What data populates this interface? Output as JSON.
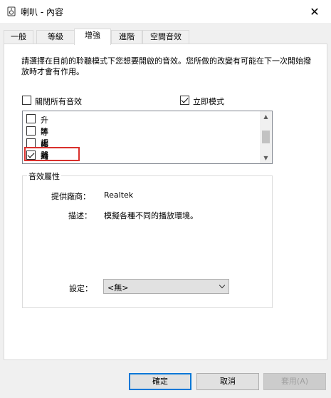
{
  "window": {
    "title": "喇叭 - 內容"
  },
  "tabs": [
    {
      "label": "一般"
    },
    {
      "label": "等級"
    },
    {
      "label": "增強"
    },
    {
      "label": "進階"
    },
    {
      "label": "空間音效"
    }
  ],
  "enhancements": {
    "description": "請選擇在目前的聆聽模式下您想要開啟的音效。您所做的改變有可能在下一次開始撥放時才會有作用。",
    "disable_all": {
      "label": "關閉所有音效",
      "checked": false
    },
    "immediate_mode": {
      "label": "立即模式",
      "checked": true
    },
    "items": [
      {
        "label": "升降調",
        "checked": false
      },
      {
        "label": "等化器",
        "checked": false
      },
      {
        "label": "虛擬環繞",
        "checked": false
      },
      {
        "label": "均衡響度",
        "checked": true
      }
    ]
  },
  "properties": {
    "title": "音效屬性",
    "provider_label": "提供廠商：",
    "provider_value": "Realtek",
    "desc_label": "描述：",
    "desc_value": "模擬各種不同的播放環境。",
    "setting_label": "設定：",
    "setting_value": "<無>"
  },
  "buttons": {
    "ok": "確定",
    "cancel": "取消",
    "apply": "套用(A)"
  },
  "colors": {
    "accent": "#0078d7",
    "highlight_box": "#d9302c"
  }
}
